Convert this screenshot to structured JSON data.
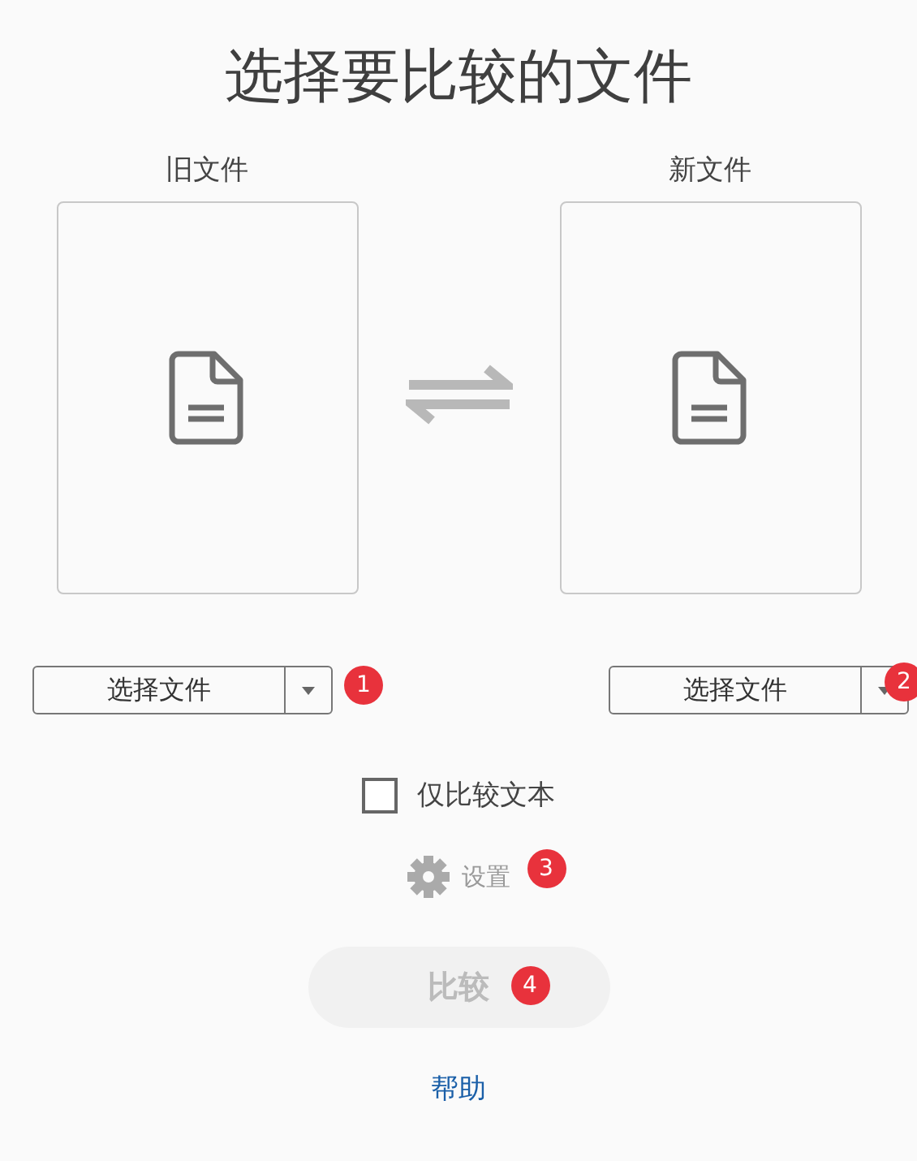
{
  "title": "选择要比较的文件",
  "files": [
    {
      "label": "旧文件",
      "button": "选择文件",
      "badge": "1"
    },
    {
      "label": "新文件",
      "button": "选择文件",
      "badge": "2"
    }
  ],
  "text_only": {
    "label": "仅比较文本",
    "checked": false
  },
  "settings": {
    "label": "设置",
    "disabled": true,
    "badge": "3"
  },
  "compare": {
    "label": "比较",
    "disabled": true,
    "badge": "4"
  },
  "help": "帮助"
}
